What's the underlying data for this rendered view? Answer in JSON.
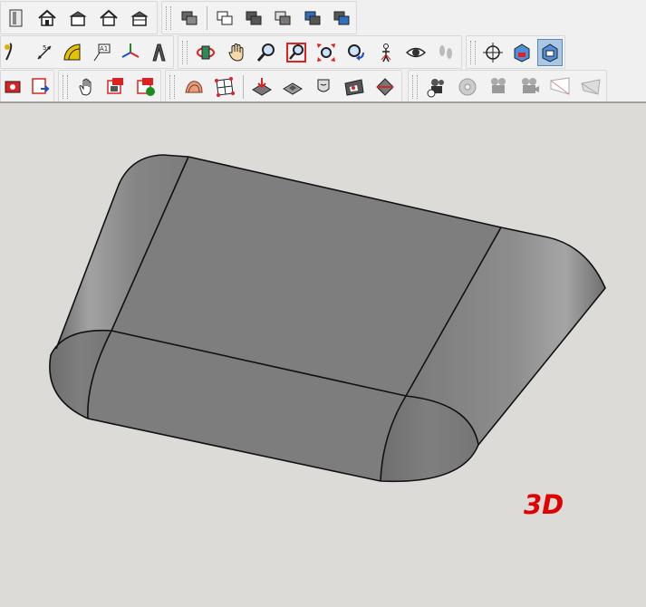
{
  "toolbar": {
    "row1": {
      "group1": [
        "file-icon",
        "home-icon",
        "home-2-icon",
        "home-3-icon",
        "home-4-icon"
      ],
      "group2": [
        "layer-icon",
        "layer-2-icon",
        "layer-3-icon",
        "layer-4-icon",
        "layer-5-icon",
        "layer-6-icon"
      ]
    },
    "row2": {
      "group1": [
        "arc-icon",
        "dimension-icon",
        "protractor-icon",
        "text-label-icon",
        "axes-icon",
        "3d-text-icon"
      ],
      "group2": [
        "orbit-icon",
        "pan-icon",
        "zoom-icon",
        "zoom-window-icon",
        "zoom-extents-icon",
        "previous-view-icon",
        "position-camera-icon",
        "look-around-icon",
        "walk-icon"
      ],
      "group3": [
        "section-plane-icon",
        "display-section-planes-icon",
        "display-section-cuts-icon"
      ]
    },
    "row3": {
      "group1": [
        "send-to-layout-icon",
        "export-icon"
      ],
      "group2": [
        "hand-icon",
        "component-icon",
        "component-2-icon"
      ],
      "group3": [
        "sandbox-contour-icon",
        "sandbox-scratch-icon"
      ],
      "group4": [
        "smoove-icon",
        "stamp-icon",
        "drape-icon",
        "add-detail-icon",
        "flip-edge-icon"
      ],
      "group5": [
        "film-advance-icon",
        "film-disc-icon",
        "film-camera-icon",
        "film-camera-2-icon",
        "film-frustum-icon",
        "film-frustum-2-icon"
      ]
    }
  },
  "viewport": {
    "background_color": "#dcdbd7",
    "view_label": "3D",
    "view_label_color": "#e00000"
  }
}
